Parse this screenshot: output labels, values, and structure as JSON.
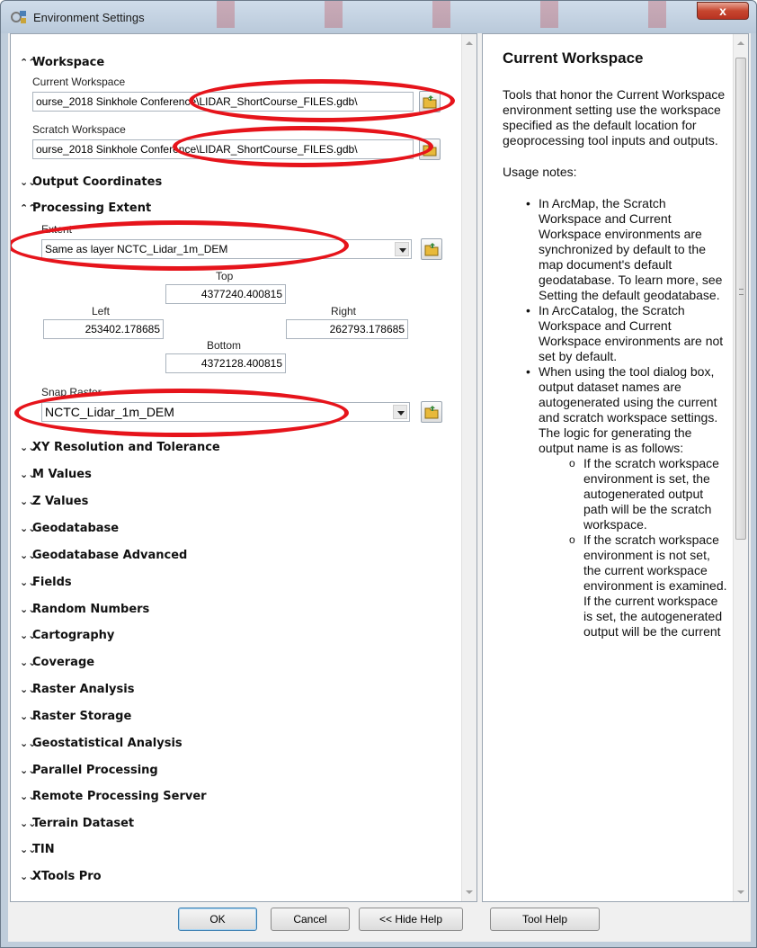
{
  "window": {
    "title": "Environment Settings",
    "close_label": "x"
  },
  "sections": {
    "workspace": "Workspace",
    "output_coordinates": "Output Coordinates",
    "processing_extent": "Processing Extent"
  },
  "workspace": {
    "current_label": "Current Workspace",
    "current_value": "ourse_2018 Sinkhole Conference\\LIDAR_ShortCourse_FILES.gdb\\",
    "scratch_label": "Scratch Workspace",
    "scratch_value": "ourse_2018 Sinkhole Conference\\LIDAR_ShortCourse_FILES.gdb\\"
  },
  "extent": {
    "label": "Extent",
    "selected": "Same as layer NCTC_Lidar_1m_DEM",
    "top_label": "Top",
    "top_value": "4377240.400815",
    "left_label": "Left",
    "left_value": "253402.178685",
    "right_label": "Right",
    "right_value": "262793.178685",
    "bottom_label": "Bottom",
    "bottom_value": "4372128.400815",
    "snap_label": "Snap Raster",
    "snap_value": "NCTC_Lidar_1m_DEM"
  },
  "collapsed_sections": [
    "XY Resolution and Tolerance",
    "M Values",
    "Z Values",
    "Geodatabase",
    "Geodatabase Advanced",
    "Fields",
    "Random Numbers",
    "Cartography",
    "Coverage",
    "Raster Analysis",
    "Raster Storage",
    "Geostatistical Analysis",
    "Parallel Processing",
    "Remote Processing Server",
    "Terrain Dataset",
    "TIN",
    "XTools Pro"
  ],
  "help": {
    "title": "Current Workspace",
    "intro": "Tools that honor the Current Workspace environment setting use the workspace specified as the default location for geoprocessing tool inputs and outputs.",
    "usage_heading": "Usage notes:",
    "bullets": [
      "In ArcMap, the Scratch Workspace and Current Workspace environments are synchronized by default to the map document's default geodatabase. To learn more, see Setting the default geodatabase.",
      "In ArcCatalog, the Scratch Workspace and Current Workspace environments are not set by default.",
      "When using the tool dialog box, output dataset names are autogenerated using the current and scratch workspace settings. The logic for generating the output name is as follows:"
    ],
    "sub_bullets": [
      "If the scratch workspace environment is set, the autogenerated output path will be the scratch workspace.",
      "If the scratch workspace environment is not set, the current workspace environment is examined. If the current workspace is set, the autogenerated output will be the current"
    ]
  },
  "buttons": {
    "ok": "OK",
    "cancel": "Cancel",
    "hide_help": "<< Hide Help",
    "tool_help": "Tool Help"
  },
  "annotation_color": "#e6141b",
  "icons": {
    "app": "environment-settings-icon",
    "folder": "open-folder-icon",
    "expand": "double-chevron-down-icon",
    "collapse": "double-chevron-up-icon"
  }
}
